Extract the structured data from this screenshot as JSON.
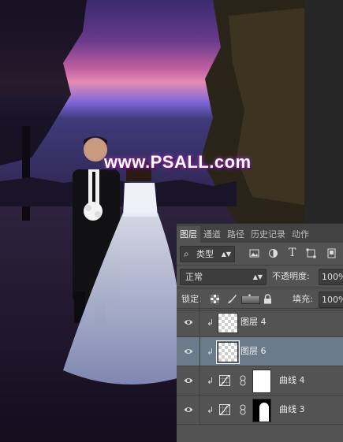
{
  "watermark": "www.PSALL.com",
  "panel": {
    "tabs": [
      {
        "label": "图层",
        "active": true
      },
      {
        "label": "通道",
        "active": false
      },
      {
        "label": "路径",
        "active": false
      },
      {
        "label": "历史记录",
        "active": false
      },
      {
        "label": "动作",
        "active": false
      }
    ],
    "filter": {
      "search_icon": "⌕",
      "kind": "类型"
    },
    "blend_mode": "正常",
    "opacity_label": "不透明度:",
    "opacity_value": "100%",
    "lock_label": "锁定:",
    "fill_label": "填充:",
    "fill_value": "100%",
    "layers": [
      {
        "name": "图层 4",
        "type": "pixel",
        "clipped": true,
        "selected": false
      },
      {
        "name": "图层 6",
        "type": "pixel",
        "clipped": true,
        "selected": true
      },
      {
        "name": "曲线 4",
        "type": "curves",
        "clipped": true,
        "selected": false,
        "mask": "white"
      },
      {
        "name": "曲线 3",
        "type": "curves",
        "clipped": true,
        "selected": false,
        "mask": "black"
      }
    ],
    "colors": {
      "selected_row": "#6b7b8c",
      "panel_bg": "#535353"
    }
  }
}
